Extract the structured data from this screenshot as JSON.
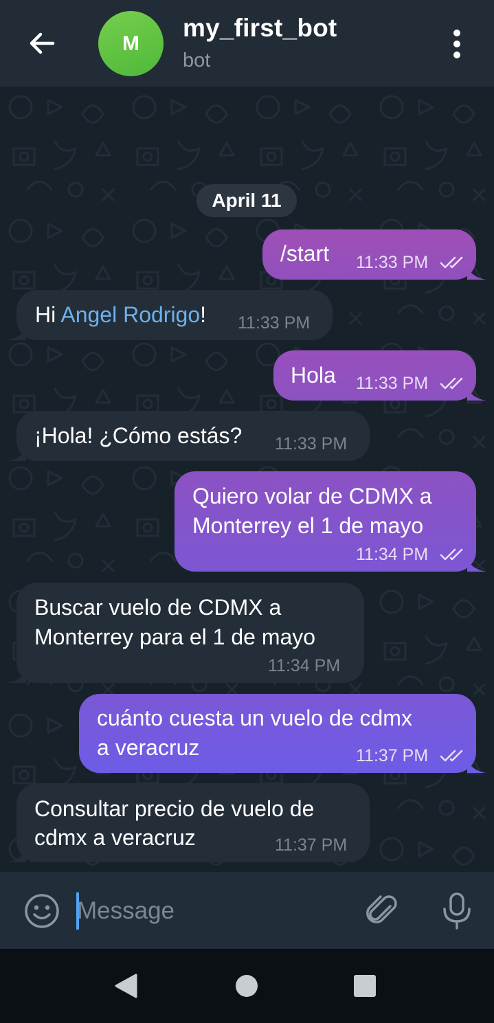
{
  "header": {
    "avatar_letter": "M",
    "title": "my_first_bot",
    "subtitle": "bot"
  },
  "chat": {
    "date": "April 11",
    "messages": [
      {
        "from": "me",
        "text": "/start",
        "time": "11:33 PM"
      },
      {
        "from": "bot",
        "text_before": "Hi ",
        "mention": "Angel Rodrigo",
        "text_after": "!",
        "time": "11:33 PM"
      },
      {
        "from": "me",
        "text": "Hola",
        "time": "11:33 PM"
      },
      {
        "from": "bot",
        "text": "¡Hola! ¿Cómo estás?",
        "time": "11:33 PM"
      },
      {
        "from": "me",
        "lines": [
          "Quiero volar de CDMX a",
          "Monterrey el 1 de mayo"
        ],
        "time": "11:34 PM"
      },
      {
        "from": "bot",
        "lines": [
          "Buscar vuelo de CDMX a",
          "Monterrey para el 1 de mayo"
        ],
        "time": "11:34 PM"
      },
      {
        "from": "me",
        "lines": [
          "cuánto cuesta un vuelo de cdmx",
          "a veracruz"
        ],
        "time": "11:37 PM"
      },
      {
        "from": "bot",
        "lines": [
          "Consultar precio de vuelo de",
          "cdmx a veracruz"
        ],
        "time": "11:37 PM"
      }
    ]
  },
  "composer": {
    "placeholder": "Message"
  },
  "icons": {
    "back": "back-arrow-icon",
    "menu": "more-vertical-icon",
    "emoji": "emoji-icon",
    "attach": "paperclip-icon",
    "mic": "microphone-icon",
    "read": "double-check-icon",
    "nav_back": "triangle-back-icon",
    "nav_home": "circle-home-icon",
    "nav_recents": "square-recents-icon"
  },
  "colors": {
    "header_bg": "#222c36",
    "chat_bg": "#17212a",
    "incoming_bubble": "#232e38",
    "outgoing_gradient_top": "#a14fb6",
    "outgoing_gradient_bottom": "#6f5ce6",
    "mention_link": "#6cb1ef",
    "avatar_green": "#5fc43f"
  }
}
